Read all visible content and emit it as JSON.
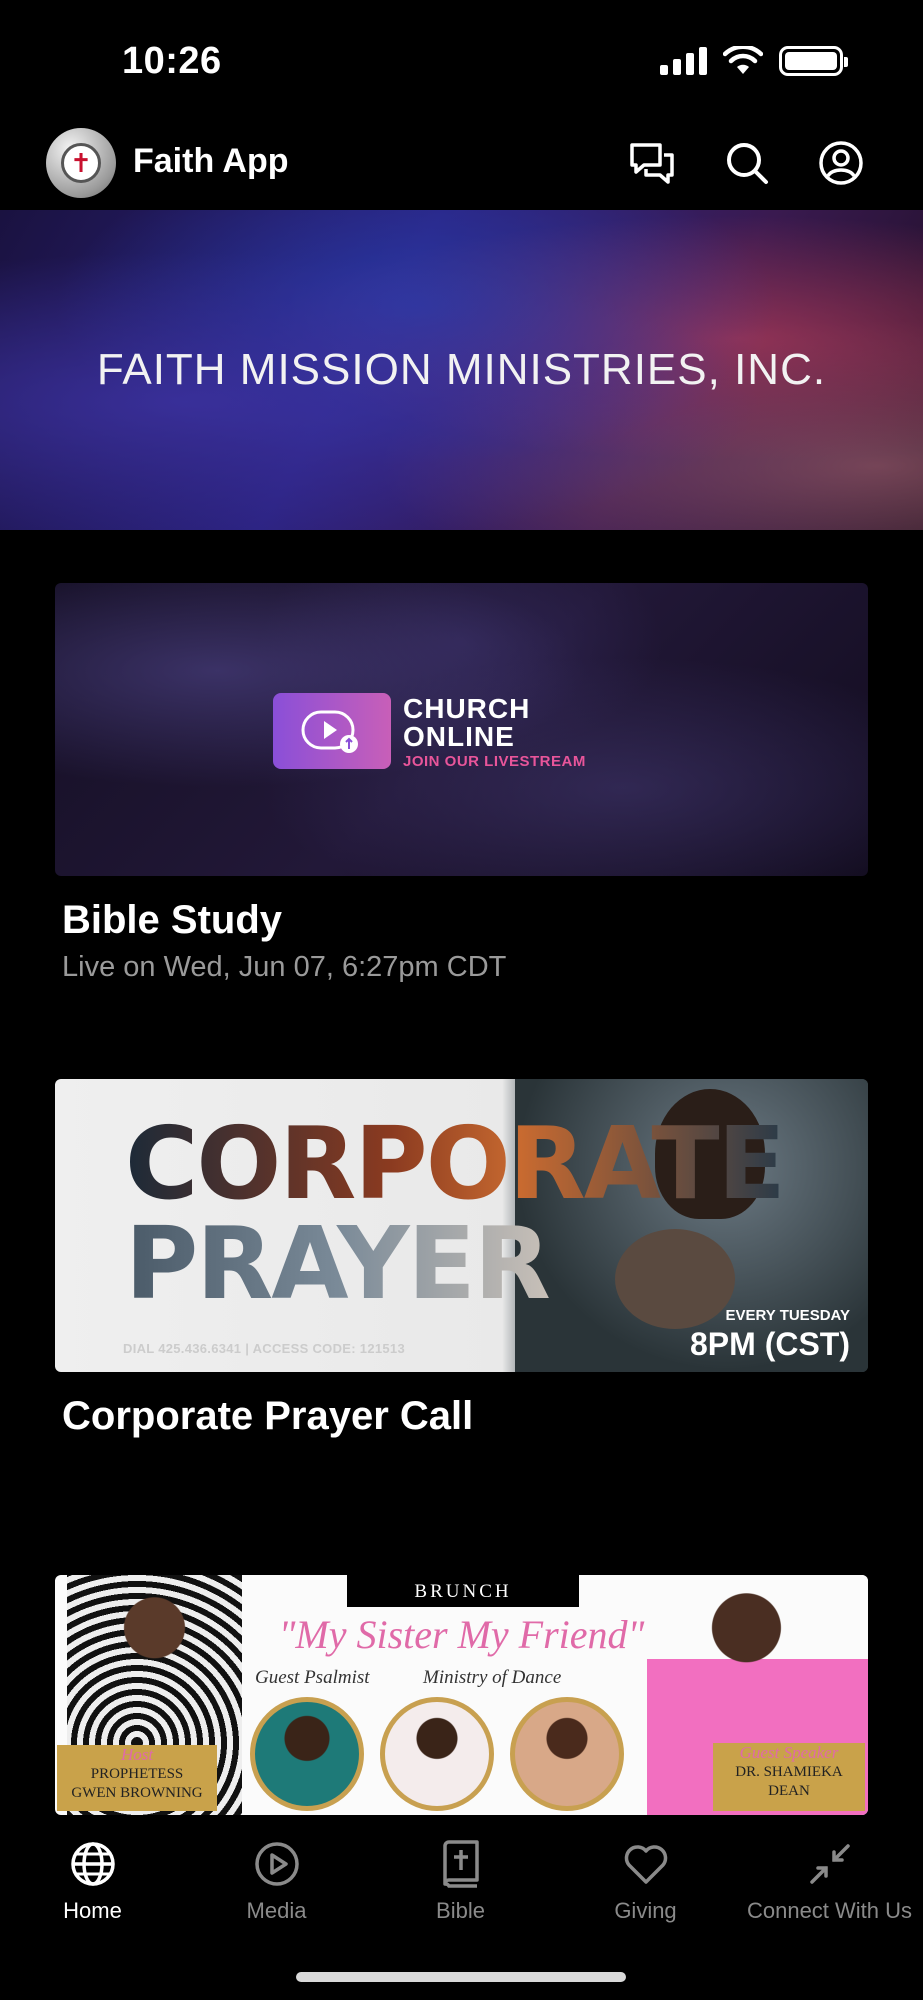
{
  "status_bar": {
    "time": "10:26"
  },
  "header": {
    "app_title": "Faith App",
    "icons": [
      "chat-icon",
      "search-icon",
      "profile-icon"
    ]
  },
  "hero": {
    "title": "FAITH MISSION MINISTRIES, INC."
  },
  "cards": [
    {
      "title": "Bible Study",
      "subtitle": "Live on Wed, Jun 07, 6:27pm CDT",
      "image_text": {
        "line1": "CHURCH",
        "line2": "ONLINE",
        "line3": "JOIN OUR LIVESTREAM"
      }
    },
    {
      "title": "Corporate Prayer Call",
      "image_text": {
        "word1": "CORPORATE",
        "word2": "PRAYER",
        "dial": "DIAL 425.436.6341 | ACCESS CODE: 121513",
        "every": "EVERY TUESDAY",
        "time": "8PM (CST)"
      }
    },
    {
      "image_text": {
        "tab": "BRUNCH",
        "title": "\"My Sister My Friend\"",
        "label_left": "Guest Psalmist",
        "label_right": "Ministry of Dance",
        "host_script": "Host",
        "host_name1": "PROPHETESS",
        "host_name2": "GWEN BROWNING",
        "speaker_script": "Guest Speaker",
        "speaker_name1": "DR. SHAMIEKA",
        "speaker_name2": "DEAN"
      }
    }
  ],
  "tabs": [
    {
      "label": "Home",
      "icon": "globe-icon",
      "active": true
    },
    {
      "label": "Media",
      "icon": "play-icon",
      "active": false
    },
    {
      "label": "Bible",
      "icon": "bible-icon",
      "active": false
    },
    {
      "label": "Giving",
      "icon": "heart-icon",
      "active": false
    },
    {
      "label": "Connect With Us",
      "icon": "connect-icon",
      "active": false
    }
  ],
  "colors": {
    "background": "#000000",
    "inactive_tab": "#8a8a8a",
    "accent_pink": "#e8559a"
  }
}
